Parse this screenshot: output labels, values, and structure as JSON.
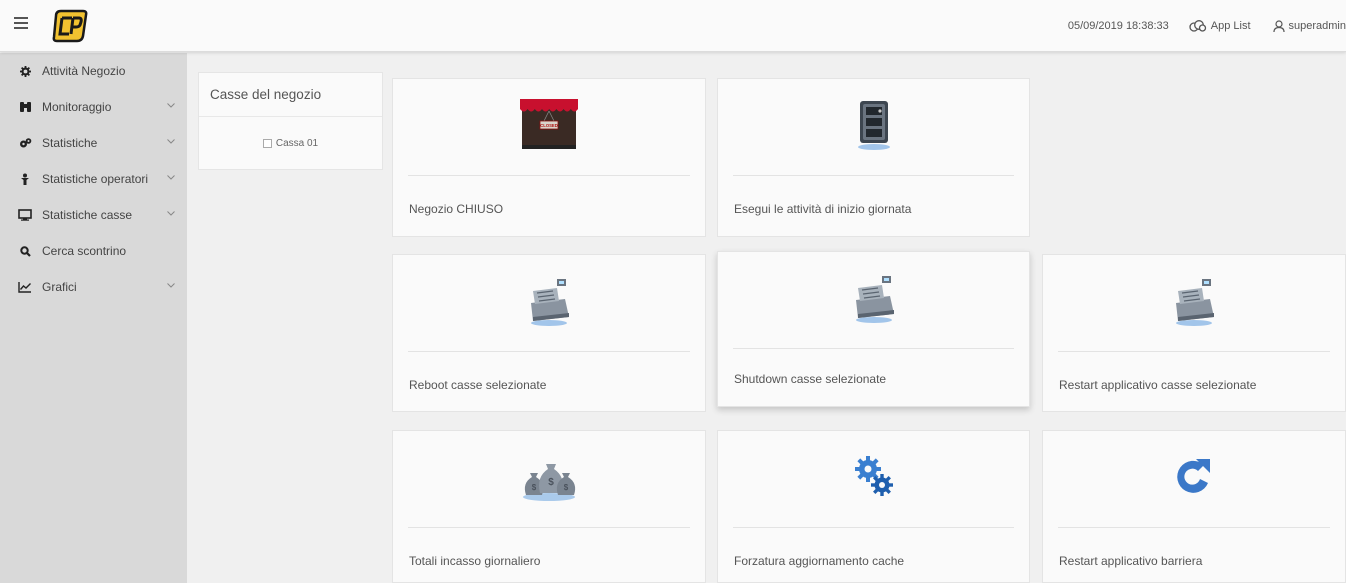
{
  "header": {
    "datetime": "05/09/2019 18:38:33",
    "app_list_label": "App List",
    "user_label": "superadmin",
    "brand_color": "#f2c230"
  },
  "sidebar": {
    "items": [
      {
        "label": "Attività Negozio",
        "icon": "gear-icon",
        "has_chevron": false
      },
      {
        "label": "Monitoraggio",
        "icon": "binoculars-icon",
        "has_chevron": true
      },
      {
        "label": "Statistiche",
        "icon": "cogs-icon",
        "has_chevron": true
      },
      {
        "label": "Statistiche operatori",
        "icon": "user-icon",
        "has_chevron": true
      },
      {
        "label": "Statistiche casse",
        "icon": "desktop-icon",
        "has_chevron": true
      },
      {
        "label": "Cerca scontrino",
        "icon": "search-icon",
        "has_chevron": false
      },
      {
        "label": "Grafici",
        "icon": "line-chart-icon",
        "has_chevron": true
      }
    ]
  },
  "casse_panel": {
    "title": "Casse del negozio",
    "registers": [
      {
        "label": "Cassa 01",
        "checked": false
      }
    ]
  },
  "cards": [
    {
      "label": "Negozio CHIUSO",
      "icon": "closed-shop-icon",
      "sign": "CLOSED"
    },
    {
      "label": "Esegui le attività di inizio giornata",
      "icon": "safe-icon"
    },
    {
      "label": "Reboot casse selezionate",
      "icon": "cash-register-icon"
    },
    {
      "label": "Shutdown casse selezionate",
      "icon": "cash-register-icon"
    },
    {
      "label": "Restart applicativo casse selezionate",
      "icon": "cash-register-icon"
    },
    {
      "label": "Totali incasso giornaliero",
      "icon": "money-bags-icon"
    },
    {
      "label": "Forzatura aggiornamento cache",
      "icon": "gears-icon"
    },
    {
      "label": "Restart applicativo barriera",
      "icon": "refresh-icon"
    }
  ]
}
